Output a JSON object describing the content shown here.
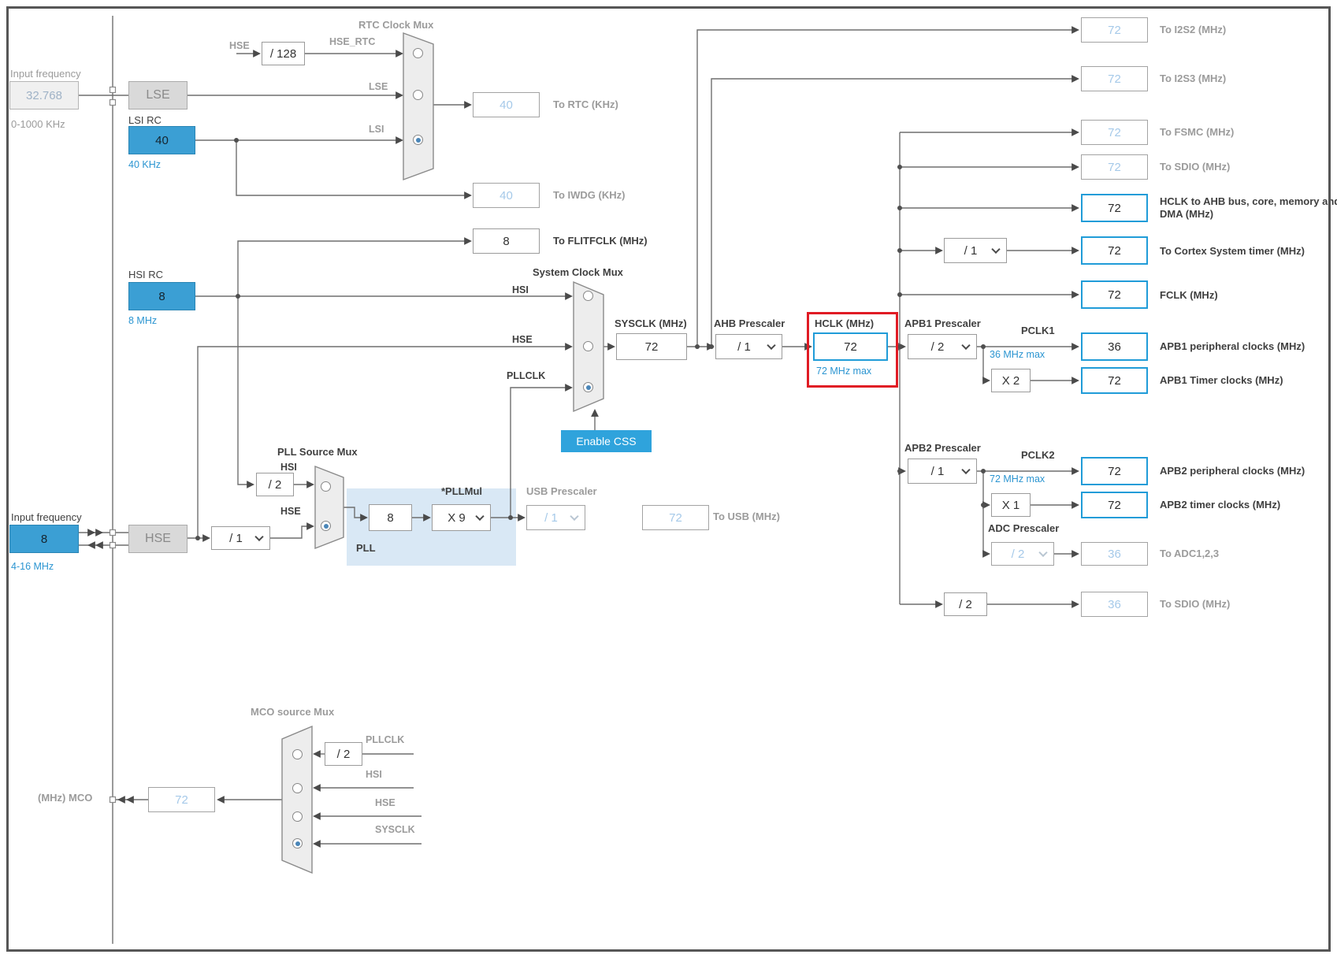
{
  "lse_input": {
    "label": "Input frequency",
    "value": "32.768",
    "range": "0-1000 KHz"
  },
  "lse_osc": {
    "label": "LSE"
  },
  "lsi_osc": {
    "title": "LSI RC",
    "value": "40",
    "freq": "40 KHz"
  },
  "hsi_osc": {
    "title": "HSI RC",
    "value": "8",
    "freq": "8 MHz"
  },
  "hse_input": {
    "label": "Input frequency",
    "value": "8",
    "range": "4-16 MHz"
  },
  "hse_osc": {
    "label": "HSE"
  },
  "hse_prediv": {
    "value": "/ 1"
  },
  "rtc_mux": {
    "title": "RTC Clock Mux",
    "hse_label": "HSE",
    "hse_div_value": "/ 128",
    "hse_rtc_label": "HSE_RTC",
    "lse_label": "LSE",
    "lsi_label": "LSI",
    "out_value": "40",
    "out_label": "To RTC (KHz)"
  },
  "iwdg": {
    "value": "40",
    "label": "To IWDG (KHz)"
  },
  "flitf": {
    "value": "8",
    "label": "To FLITFCLK (MHz)"
  },
  "sys_mux": {
    "title": "System Clock Mux",
    "hsi_label": "HSI",
    "hse_label": "HSE",
    "pllclk_label": "PLLCLK",
    "enable_css_label": "Enable CSS"
  },
  "sysclk": {
    "label": "SYSCLK (MHz)",
    "value": "72"
  },
  "ahb": {
    "label": "AHB Prescaler",
    "value": "/ 1"
  },
  "hclk": {
    "label": "HCLK (MHz)",
    "value": "72",
    "max_note": "72 MHz max"
  },
  "apb1": {
    "label": "APB1 Prescaler",
    "value": "/ 2",
    "pclk_label": "PCLK1",
    "max_note": "36 MHz max",
    "periph_value": "36",
    "periph_label": "APB1 peripheral clocks (MHz)",
    "mul_value": "X 2",
    "timer_value": "72",
    "timer_label": "APB1 Timer clocks (MHz)"
  },
  "apb2": {
    "label": "APB2 Prescaler",
    "value": "/ 1",
    "pclk_label": "PCLK2",
    "max_note": "72 MHz max",
    "periph_value": "72",
    "periph_label": "APB2 peripheral clocks (MHz)",
    "mul_value": "X 1",
    "timer_value": "72",
    "timer_label": "APB2 timer clocks (MHz)"
  },
  "adc": {
    "label": "ADC Prescaler",
    "value": "/ 2",
    "out_value": "36",
    "out_label": "To ADC1,2,3"
  },
  "sdio_div": {
    "value": "/ 2",
    "out_value": "36",
    "out_label": "To SDIO (MHz)"
  },
  "i2s2": {
    "value": "72",
    "label": "To I2S2 (MHz)"
  },
  "i2s3": {
    "value": "72",
    "label": "To I2S3 (MHz)"
  },
  "fsmc": {
    "value": "72",
    "label": "To FSMC (MHz)"
  },
  "sdio_top": {
    "value": "72",
    "label": "To SDIO (MHz)"
  },
  "hclk_ahb": {
    "value": "72",
    "label": "HCLK to AHB bus, core, memory and DMA (MHz)"
  },
  "cortex": {
    "prescaler_value": "/ 1",
    "value": "72",
    "label": "To Cortex System timer (MHz)"
  },
  "fclk": {
    "value": "72",
    "label": "FCLK (MHz)"
  },
  "pll": {
    "title": "PLL Source Mux",
    "hsi_label": "HSI",
    "hsi_div_value": "/ 2",
    "hse_label": "HSE",
    "block_label": "PLL",
    "mul_label": "*PLLMul",
    "input_value": "8",
    "mul_value": "X 9"
  },
  "usb": {
    "label": "USB Prescaler",
    "value": "/ 1",
    "out_value": "72",
    "out_label": "To USB (MHz)"
  },
  "mco": {
    "title": "MCO source Mux",
    "div_value": "/ 2",
    "pllclk_label": "PLLCLK",
    "hsi_label": "HSI",
    "hse_label": "HSE",
    "sysclk_label": "SYSCLK",
    "out_value": "72",
    "out_label": "(MHz) MCO"
  }
}
